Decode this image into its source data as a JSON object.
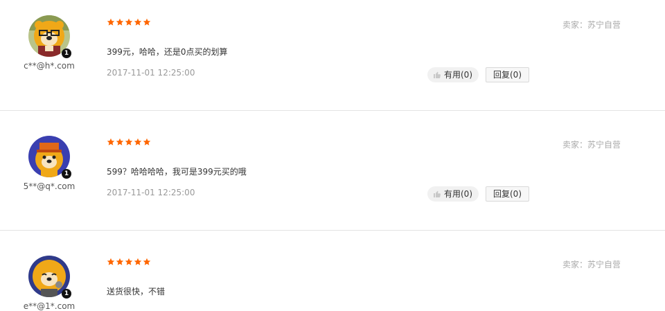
{
  "colors": {
    "star": "#ff6600",
    "seller_text": "#aaaaaa",
    "date_text": "#999999",
    "divider": "#e3e3e3",
    "useful_bg": "#f1f1f1",
    "reply_border": "#d9d9d9"
  },
  "reviews": [
    {
      "username": "c**@h*.com",
      "rating": 5,
      "content": "399元，哈哈，还是0点买的划算",
      "date": "2017-11-01 12:25:00",
      "seller": "卖家：苏宁自营",
      "useful_label": "有用(0)",
      "reply_label": "回复(0)",
      "badge": "1",
      "avatar_icon": "lion-mascot-glasses-icon"
    },
    {
      "username": "5**@q*.com",
      "rating": 5,
      "content": "599？哈哈哈哈，我可是399元买的哦",
      "date": "2017-11-01 12:25:00",
      "seller": "卖家：苏宁自营",
      "useful_label": "有用(0)",
      "reply_label": "回复(0)",
      "badge": "1",
      "avatar_icon": "lion-mascot-hat-icon"
    },
    {
      "username": "e**@1*.com",
      "rating": 5,
      "content": "送货很快，不错",
      "seller": "卖家：苏宁自营",
      "badge": "1",
      "avatar_icon": "lion-mascot-sleeping-icon"
    }
  ]
}
